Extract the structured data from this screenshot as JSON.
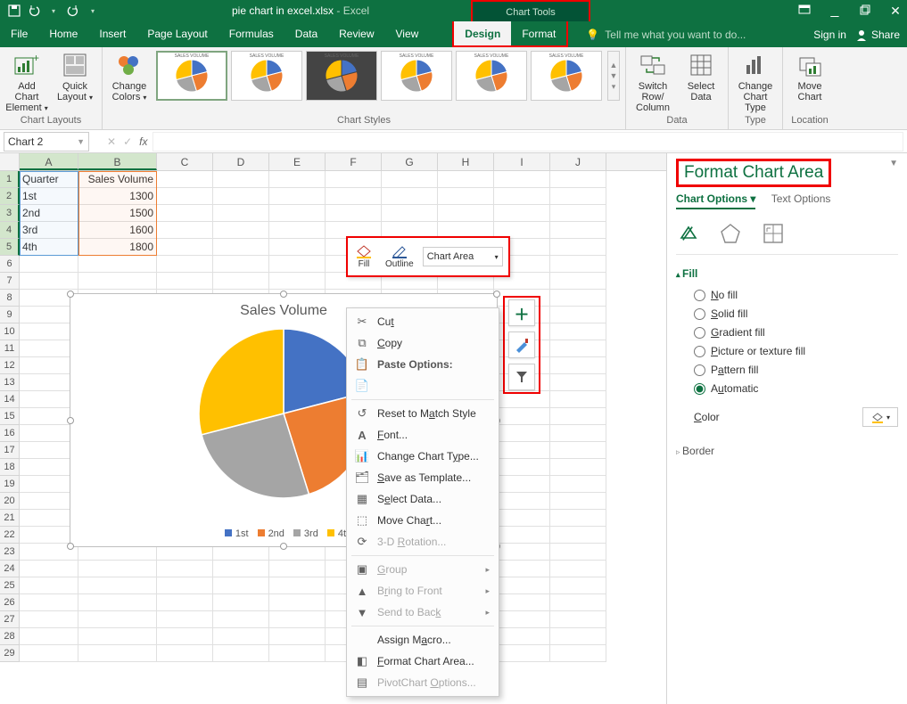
{
  "titlebar": {
    "doc_name": "pie chart in excel.xlsx",
    "app_name": "Excel",
    "chart_tools": "Chart Tools"
  },
  "tabs": {
    "file": "File",
    "home": "Home",
    "insert": "Insert",
    "page_layout": "Page Layout",
    "formulas": "Formulas",
    "data": "Data",
    "review": "Review",
    "view": "View",
    "design": "Design",
    "format": "Format",
    "tell_me": "Tell me what you want to do...",
    "sign_in": "Sign in",
    "share": "Share"
  },
  "ribbon": {
    "add_chart_element": "Add Chart Element",
    "quick_layout": "Quick Layout",
    "change_colors": "Change Colors",
    "switch_row_col": "Switch Row/ Column",
    "select_data": "Select Data",
    "change_chart_type": "Change Chart Type",
    "move_chart": "Move Chart",
    "g_layouts": "Chart Layouts",
    "g_styles": "Chart Styles",
    "g_data": "Data",
    "g_type": "Type",
    "g_location": "Location"
  },
  "namebox": "Chart 2",
  "columns": [
    "A",
    "B",
    "C",
    "D",
    "E",
    "F",
    "G",
    "H",
    "I",
    "J"
  ],
  "row_count": 29,
  "table": {
    "headers": {
      "A": "Quarter",
      "B": "Sales Volume"
    },
    "rows": [
      {
        "A": "1st",
        "B": "1300"
      },
      {
        "A": "2nd",
        "B": "1500"
      },
      {
        "A": "3rd",
        "B": "1600"
      },
      {
        "A": "4th",
        "B": "1800"
      }
    ]
  },
  "chart_data": {
    "type": "pie",
    "title": "Sales Volume",
    "categories": [
      "1st",
      "2nd",
      "3rd",
      "4th"
    ],
    "values": [
      1300,
      1500,
      1600,
      1800
    ],
    "colors": [
      "#4472c4",
      "#ed7d31",
      "#a5a5a5",
      "#ffc000"
    ]
  },
  "mini_toolbar": {
    "fill": "Fill",
    "outline": "Outline",
    "chart_area": "Chart Area"
  },
  "context_menu": {
    "cut": "Cut",
    "copy": "Copy",
    "paste_options": "Paste Options:",
    "reset": "Reset to Match Style",
    "font": "Font...",
    "change_type": "Change Chart Type...",
    "save_template": "Save as Template...",
    "select_data": "Select Data...",
    "move_chart": "Move Chart...",
    "rotation": "3-D Rotation...",
    "group": "Group",
    "bring_front": "Bring to Front",
    "send_back": "Send to Back",
    "assign_macro": "Assign Macro...",
    "format_area": "Format Chart Area...",
    "pivot_opts": "PivotChart Options..."
  },
  "chart_buttons": {
    "plus": "+",
    "brush": "brush",
    "filter": "filter"
  },
  "pane": {
    "title": "Format Chart Area",
    "chart_options": "Chart Options",
    "text_options": "Text Options",
    "fill_section": "Fill",
    "border_section": "Border",
    "fill_opts": {
      "no_fill": "No fill",
      "solid": "Solid fill",
      "gradient": "Gradient fill",
      "picture": "Picture or texture fill",
      "pattern": "Pattern fill",
      "auto": "Automatic"
    },
    "color_label": "Color"
  }
}
